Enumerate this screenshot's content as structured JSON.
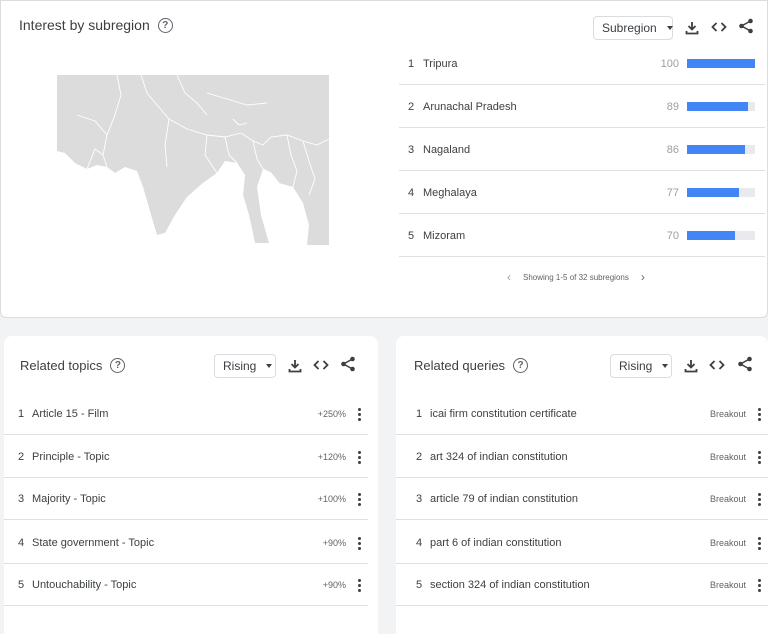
{
  "subregion": {
    "title": "Interest by subregion",
    "select_value": "Subregion",
    "rows": [
      {
        "rank": "1",
        "name": "Tripura",
        "value": 100
      },
      {
        "rank": "2",
        "name": "Arunachal Pradesh",
        "value": 89
      },
      {
        "rank": "3",
        "name": "Nagaland",
        "value": 86
      },
      {
        "rank": "4",
        "name": "Meghalaya",
        "value": 77
      },
      {
        "rank": "5",
        "name": "Mizoram",
        "value": 70
      }
    ],
    "pager_text": "Showing 1-5 of 32 subregions"
  },
  "topics": {
    "title": "Related topics",
    "select_value": "Rising",
    "rows": [
      {
        "rank": "1",
        "name": "Article 15 - Film",
        "value": "+250%"
      },
      {
        "rank": "2",
        "name": "Principle - Topic",
        "value": "+120%"
      },
      {
        "rank": "3",
        "name": "Majority - Topic",
        "value": "+100%"
      },
      {
        "rank": "4",
        "name": "State government - Topic",
        "value": "+90%"
      },
      {
        "rank": "5",
        "name": "Untouchability - Topic",
        "value": "+90%"
      }
    ]
  },
  "queries": {
    "title": "Related queries",
    "select_value": "Rising",
    "rows": [
      {
        "rank": "1",
        "name": "icai firm constitution certificate",
        "value": "Breakout"
      },
      {
        "rank": "2",
        "name": "art 324 of indian constitution",
        "value": "Breakout"
      },
      {
        "rank": "3",
        "name": "article 79 of indian constitution",
        "value": "Breakout"
      },
      {
        "rank": "4",
        "name": "part 6 of indian constitution",
        "value": "Breakout"
      },
      {
        "rank": "5",
        "name": "section 324 of indian constitution",
        "value": "Breakout"
      }
    ]
  },
  "icons": {
    "help": "help-circle-icon",
    "download": "download-icon",
    "embed": "code-icon",
    "share": "share-icon",
    "more": "more-vert-icon",
    "prev": "chevron-left-icon",
    "next": "chevron-right-icon"
  },
  "colors": {
    "bar": "#4285f4",
    "bar_track": "#e8eaed",
    "map_land": "#dcdcdc"
  }
}
